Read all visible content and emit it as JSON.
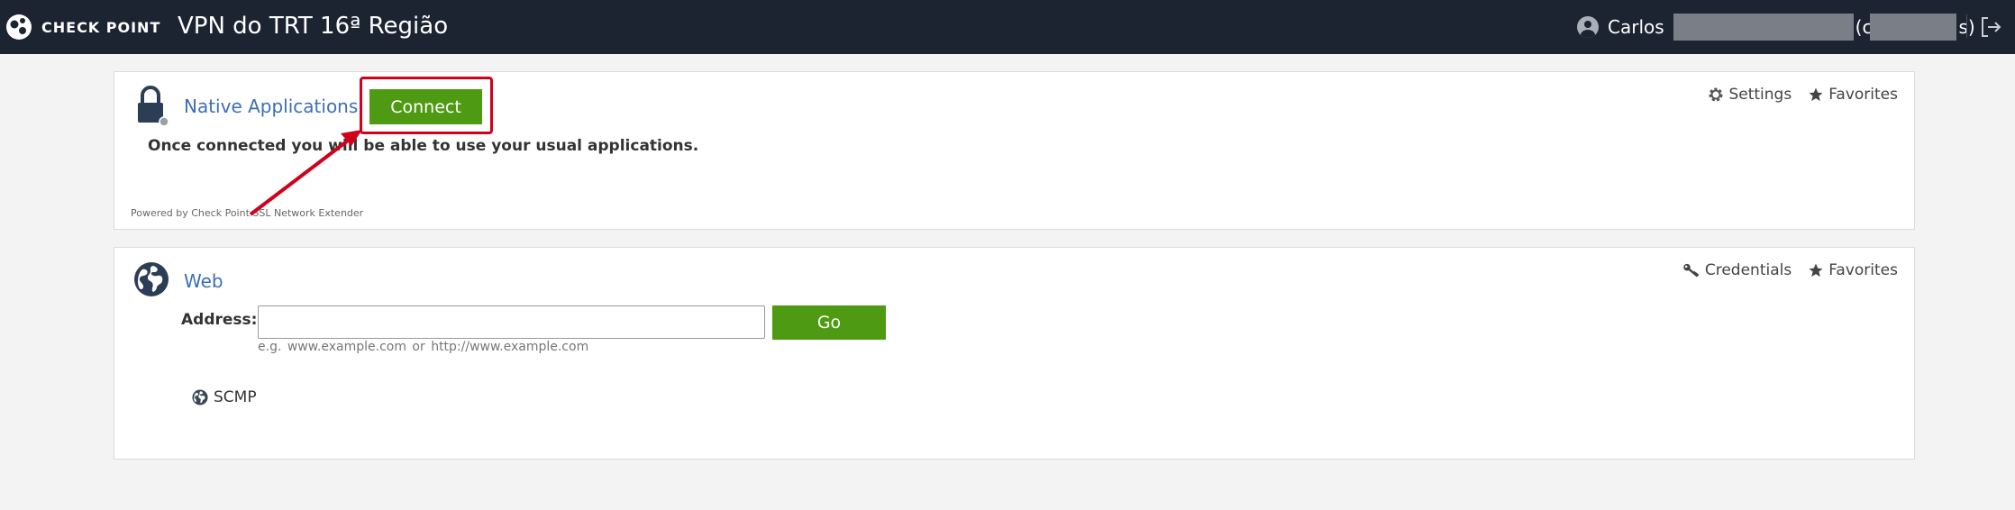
{
  "header": {
    "logo_text": "CHECK POINT",
    "title": "VPN do TRT 16ª Região",
    "user_first": "Carlos",
    "user_open": "(c",
    "user_close": "s)"
  },
  "native_apps": {
    "title": "Native Applications",
    "connect_label": "Connect",
    "description": "Once connected you will be able to use your usual applications.",
    "powered_by": "Powered by Check Point SSL Network Extender",
    "settings_label": "Settings",
    "favorites_label": "Favorites"
  },
  "web": {
    "title": "Web",
    "address_label": "Address:",
    "address_value": "",
    "go_label": "Go",
    "hint": "e.g.  www.example.com  or  http://www.example.com",
    "credentials_label": "Credentials",
    "favorites_label": "Favorites",
    "bookmarks": [
      {
        "label": "SCMP"
      }
    ]
  },
  "colors": {
    "header_bg": "#1c2331",
    "accent_green": "#4e9a13",
    "link_blue": "#3d6fb6",
    "annotation_red": "#d0021b"
  },
  "icons": [
    "checkpoint-logo",
    "user-icon",
    "logout-icon",
    "lock-icon",
    "gear-icon",
    "star-icon",
    "globe-icon",
    "key-icon"
  ]
}
